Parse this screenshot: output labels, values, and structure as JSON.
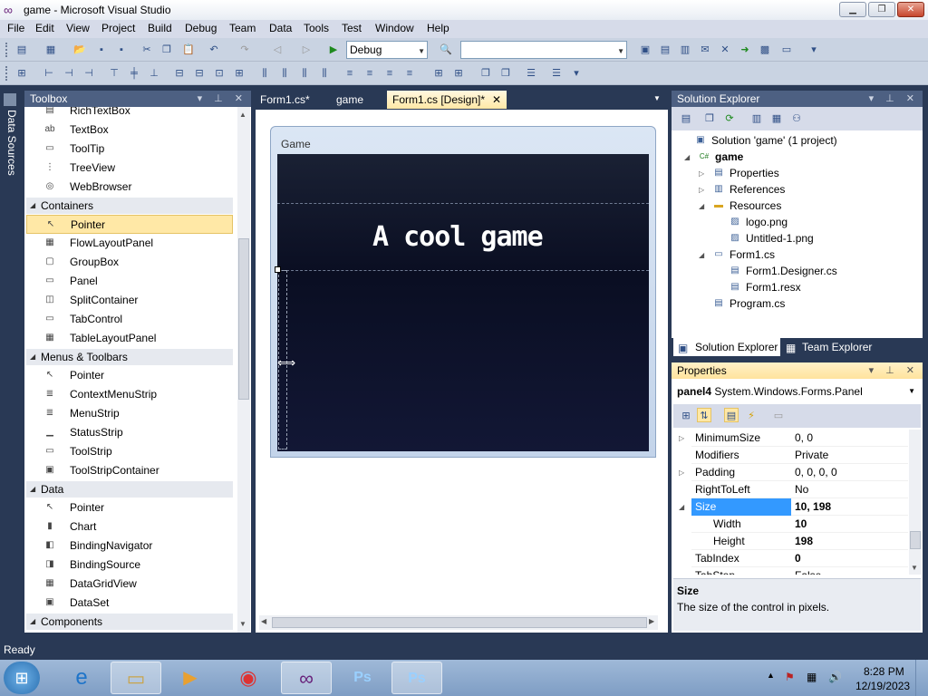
{
  "window": {
    "title": "game - Microsoft Visual Studio"
  },
  "menu": [
    "File",
    "Edit",
    "View",
    "Project",
    "Build",
    "Debug",
    "Team",
    "Data",
    "Tools",
    "Test",
    "Window",
    "Help"
  ],
  "toolbar": {
    "config": "Debug",
    "platform": ""
  },
  "left_strip": {
    "label": "Data Sources"
  },
  "toolbox": {
    "title": "Toolbox",
    "items": [
      {
        "kind": "item",
        "label": "RichTextBox",
        "icon": "richtextbox-icon"
      },
      {
        "kind": "item",
        "label": "TextBox",
        "icon": "textbox-icon"
      },
      {
        "kind": "item",
        "label": "ToolTip",
        "icon": "tooltip-icon"
      },
      {
        "kind": "item",
        "label": "TreeView",
        "icon": "treeview-icon"
      },
      {
        "kind": "item",
        "label": "WebBrowser",
        "icon": "webbrowser-icon"
      },
      {
        "kind": "category",
        "label": "Containers"
      },
      {
        "kind": "item",
        "label": "Pointer",
        "icon": "pointer-icon",
        "selected": true
      },
      {
        "kind": "item",
        "label": "FlowLayoutPanel",
        "icon": "flowlayoutpanel-icon"
      },
      {
        "kind": "item",
        "label": "GroupBox",
        "icon": "groupbox-icon"
      },
      {
        "kind": "item",
        "label": "Panel",
        "icon": "panel-icon"
      },
      {
        "kind": "item",
        "label": "SplitContainer",
        "icon": "splitcontainer-icon"
      },
      {
        "kind": "item",
        "label": "TabControl",
        "icon": "tabcontrol-icon"
      },
      {
        "kind": "item",
        "label": "TableLayoutPanel",
        "icon": "tablelayoutpanel-icon"
      },
      {
        "kind": "category",
        "label": "Menus & Toolbars"
      },
      {
        "kind": "item",
        "label": "Pointer",
        "icon": "pointer-icon"
      },
      {
        "kind": "item",
        "label": "ContextMenuStrip",
        "icon": "contextmenustrip-icon"
      },
      {
        "kind": "item",
        "label": "MenuStrip",
        "icon": "menustrip-icon"
      },
      {
        "kind": "item",
        "label": "StatusStrip",
        "icon": "statusstrip-icon"
      },
      {
        "kind": "item",
        "label": "ToolStrip",
        "icon": "toolstrip-icon"
      },
      {
        "kind": "item",
        "label": "ToolStripContainer",
        "icon": "toolstripcontainer-icon"
      },
      {
        "kind": "category",
        "label": "Data"
      },
      {
        "kind": "item",
        "label": "Pointer",
        "icon": "pointer-icon"
      },
      {
        "kind": "item",
        "label": "Chart",
        "icon": "chart-icon"
      },
      {
        "kind": "item",
        "label": "BindingNavigator",
        "icon": "bindingnavigator-icon"
      },
      {
        "kind": "item",
        "label": "BindingSource",
        "icon": "bindingsource-icon"
      },
      {
        "kind": "item",
        "label": "DataGridView",
        "icon": "datagridview-icon"
      },
      {
        "kind": "item",
        "label": "DataSet",
        "icon": "dataset-icon"
      },
      {
        "kind": "category",
        "label": "Components"
      }
    ]
  },
  "doc_tabs": [
    "Form1.cs*",
    "game",
    "Form1.cs [Design]*"
  ],
  "form": {
    "caption": "Game",
    "heading": "A cool game"
  },
  "solution_explorer": {
    "title": "Solution Explorer",
    "nodes": [
      {
        "label": "Solution 'game' (1 project)",
        "icon": "solution-icon",
        "twisty": ""
      },
      {
        "label": "game",
        "icon": "csharp-project-icon",
        "twisty": "◢",
        "bold": true
      },
      {
        "label": "Properties",
        "icon": "properties-folder-icon",
        "twisty": "▷"
      },
      {
        "label": "References",
        "icon": "references-icon",
        "twisty": "▷"
      },
      {
        "label": "Resources",
        "icon": "folder-icon",
        "twisty": "◢"
      },
      {
        "label": "logo.png",
        "icon": "image-file-icon",
        "twisty": ""
      },
      {
        "label": "Untitled-1.png",
        "icon": "image-file-icon",
        "twisty": ""
      },
      {
        "label": "Form1.cs",
        "icon": "form-icon",
        "twisty": "◢"
      },
      {
        "label": "Form1.Designer.cs",
        "icon": "cs-file-icon",
        "twisty": ""
      },
      {
        "label": "Form1.resx",
        "icon": "resx-file-icon",
        "twisty": ""
      },
      {
        "label": "Program.cs",
        "icon": "cs-file-icon",
        "twisty": ""
      }
    ],
    "bottom_tabs": [
      "Solution Explorer",
      "Team Explorer"
    ]
  },
  "properties": {
    "title": "Properties",
    "object": "panel4",
    "type": "System.Windows.Forms.Panel",
    "rows": [
      {
        "name": "MinimumSize",
        "value": "0, 0",
        "twisty": "▷"
      },
      {
        "name": "Modifiers",
        "value": "Private",
        "twisty": ""
      },
      {
        "name": "Padding",
        "value": "0, 0, 0, 0",
        "twisty": "▷"
      },
      {
        "name": "RightToLeft",
        "value": "No",
        "twisty": ""
      },
      {
        "name": "Size",
        "value": "10, 198",
        "twisty": "◢",
        "selected": true,
        "bold": true
      },
      {
        "name": "Width",
        "value": "10",
        "indent": true,
        "bold": true
      },
      {
        "name": "Height",
        "value": "198",
        "indent": true,
        "bold": true
      },
      {
        "name": "TabIndex",
        "value": "0",
        "bold": true
      },
      {
        "name": "TabStop",
        "value": "False"
      }
    ],
    "desc_title": "Size",
    "desc_text": "The size of the control in pixels."
  },
  "status": {
    "text": "Ready"
  },
  "taskbar": {
    "time": "8:28 PM",
    "date": "12/19/2023"
  }
}
